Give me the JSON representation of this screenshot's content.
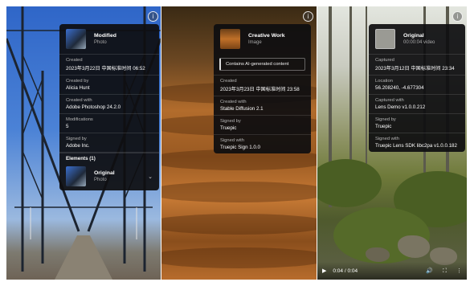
{
  "cards": [
    {
      "title": "Modified",
      "subtitle": "Photo",
      "rows": [
        {
          "label": "Created",
          "value": "2023年3月22日 中国标准时间 06:52"
        },
        {
          "label": "Created by",
          "value": "Alicia Hunt"
        },
        {
          "label": "Created with",
          "value": "Adobe Photoshop 24.2.0"
        },
        {
          "label": "Modifications",
          "value": "5"
        },
        {
          "label": "Signed by",
          "value": "Adobe Inc."
        }
      ],
      "elements_label": "Elements (1)",
      "element": {
        "title": "Original",
        "subtitle": "Photo"
      }
    },
    {
      "title": "Creative Work",
      "subtitle": "Image",
      "badge": "Contains AI-generated content",
      "rows": [
        {
          "label": "Created",
          "value": "2023年3月23日 中国标准时间 23:58"
        },
        {
          "label": "Created with",
          "value": "Stable Diffusion 2.1"
        },
        {
          "label": "Signed by",
          "value": "Truepic"
        },
        {
          "label": "Signed with",
          "value": "Truepic Sign 1.0.0"
        }
      ]
    },
    {
      "title": "Original",
      "subtitle": "00:00:04 video",
      "rows": [
        {
          "label": "Captured",
          "value": "2023年3月12日 中国标准时间 23:34"
        },
        {
          "label": "Location",
          "value": "56.208240, -4.677304"
        },
        {
          "label": "Captured with",
          "value": "Lens Demo v1.0.0.212"
        },
        {
          "label": "Signed by",
          "value": "Truepic"
        },
        {
          "label": "Signed with",
          "value": "Truepic Lens SDK libc2pa v1.0.0.182"
        }
      ]
    }
  ],
  "info_glyph": "i",
  "video": {
    "time": "0:04 / 0:04",
    "play_icon": "play-icon",
    "volume_icon": "volume-icon",
    "fullscreen_icon": "fullscreen-icon",
    "more_icon": "more-icon"
  }
}
